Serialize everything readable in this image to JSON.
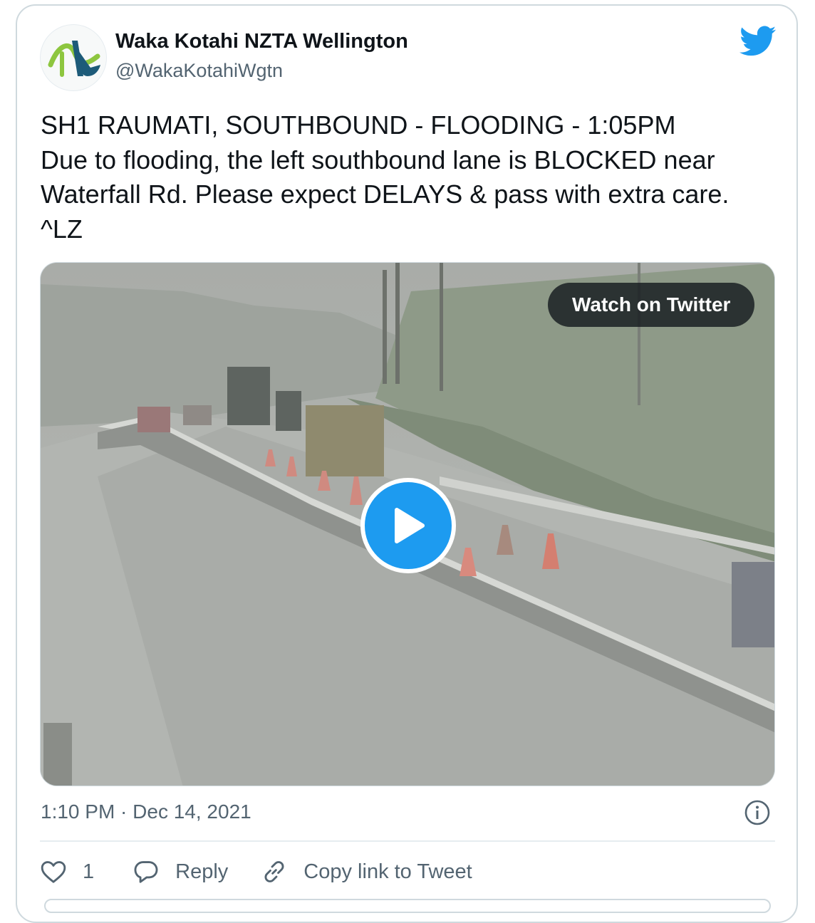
{
  "author": {
    "display_name": "Waka Kotahi NZTA Wellington",
    "handle": "@WakaKotahiWgtn"
  },
  "tweet": {
    "lines": [
      "SH1 RAUMATI, SOUTHBOUND - FLOODING - 1:05PM",
      "Due to flooding, the left southbound lane is BLOCKED near",
      "Waterfall Rd. Please expect DELAYS & pass with extra care.",
      "^LZ"
    ]
  },
  "media": {
    "watch_label": "Watch on Twitter",
    "play_icon": "play-icon"
  },
  "meta": {
    "timestamp": "1:10 PM · Dec 14, 2021"
  },
  "actions": {
    "like_count": "1",
    "reply_label": "Reply",
    "copy_link_label": "Copy link to Tweet"
  },
  "colors": {
    "twitter_blue": "#1d9bf0",
    "secondary_text": "#536471",
    "border": "#cfd9de"
  }
}
